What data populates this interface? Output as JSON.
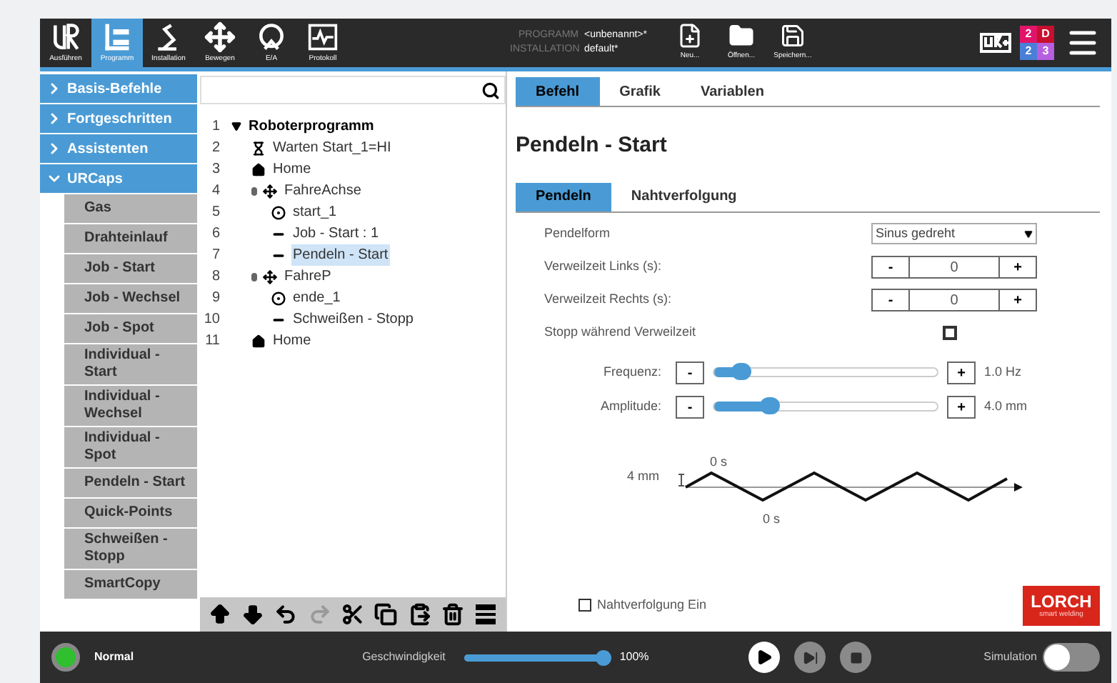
{
  "header": {
    "nav": [
      {
        "label": "Ausführen",
        "kind": "ur",
        "selected": false
      },
      {
        "label": "Programm",
        "kind": "program",
        "selected": true
      },
      {
        "label": "Installation",
        "kind": "robot",
        "selected": false
      },
      {
        "label": "Bewegen",
        "kind": "move",
        "selected": false
      },
      {
        "label": "E/A",
        "kind": "io",
        "selected": false
      },
      {
        "label": "Protokoll",
        "kind": "log",
        "selected": false
      }
    ],
    "program_label": "PROGRAMM",
    "program_value": "<unbenannt>*",
    "installation_label": "INSTALLATION",
    "installation_value": "default*",
    "file_buttons": [
      {
        "label": "Neu...",
        "kind": "new"
      },
      {
        "label": "Öffnen...",
        "kind": "open"
      },
      {
        "label": "Speichern...",
        "kind": "save"
      }
    ],
    "badge": [
      {
        "text": "2",
        "color": "#e0156a"
      },
      {
        "text": "D",
        "color": "#c8102e"
      },
      {
        "text": "2",
        "color": "#4a7fd8"
      },
      {
        "text": "3",
        "color": "#b65fe0"
      }
    ]
  },
  "sidebar": {
    "categories": [
      {
        "label": "Basis-Befehle",
        "expanded": false
      },
      {
        "label": "Fortgeschritten",
        "expanded": false
      },
      {
        "label": "Assistenten",
        "expanded": false
      },
      {
        "label": "URCaps",
        "expanded": true
      }
    ],
    "items": [
      "Gas",
      "Drahteinlauf",
      "Job - Start",
      "Job - Wechsel",
      "Job - Spot",
      "Individual - Start",
      "Individual - Wechsel",
      "Individual - Spot",
      "Pendeln - Start",
      "Quick-Points",
      "Schweißen - Stopp",
      "SmartCopy"
    ]
  },
  "tree": {
    "rows": [
      {
        "number": "1",
        "label": "Roboterprogramm",
        "kind": "root",
        "selected": false,
        "children": [
          {
            "number": "2",
            "label": "Warten Start_1=HI",
            "kind": "wait",
            "selected": false
          },
          {
            "number": "3",
            "label": "Home",
            "kind": "home",
            "selected": false
          },
          {
            "number": "4",
            "label": "FahreAchse",
            "kind": "move",
            "selected": false,
            "children": [
              {
                "number": "5",
                "label": "start_1",
                "kind": "waypoint",
                "selected": false
              },
              {
                "number": "6",
                "label": "Job - Start : 1",
                "kind": "command",
                "selected": false
              },
              {
                "number": "7",
                "label": "Pendeln - Start",
                "kind": "command",
                "selected": true
              }
            ]
          },
          {
            "number": "8",
            "label": "FahreP",
            "kind": "move",
            "selected": false,
            "children": [
              {
                "number": "9",
                "label": "ende_1",
                "kind": "waypoint",
                "selected": false
              },
              {
                "number": "10",
                "label": "Schweißen - Stopp",
                "kind": "command",
                "selected": false
              }
            ]
          },
          {
            "number": "11",
            "label": "Home",
            "kind": "home",
            "selected": false
          }
        ]
      }
    ],
    "toolbar": [
      {
        "kind": "up",
        "disabled": false
      },
      {
        "kind": "down",
        "disabled": false
      },
      {
        "kind": "undo",
        "disabled": false
      },
      {
        "kind": "redo",
        "disabled": true
      },
      {
        "kind": "cut",
        "disabled": false
      },
      {
        "kind": "copy",
        "disabled": false
      },
      {
        "kind": "paste",
        "disabled": false
      },
      {
        "kind": "delete",
        "disabled": false
      },
      {
        "kind": "suppress",
        "disabled": false
      }
    ]
  },
  "tabs": [
    {
      "label": "Befehl",
      "selected": true
    },
    {
      "label": "Grafik",
      "selected": false
    },
    {
      "label": "Variablen",
      "selected": false
    }
  ],
  "title": "Pendeln - Start",
  "subtabs": [
    {
      "label": "Pendeln",
      "selected": true
    },
    {
      "label": "Nahtverfolgung",
      "selected": false
    }
  ],
  "form": [
    {
      "kind": "dropdown",
      "label": "Pendelform",
      "value": "Sinus gedreht"
    },
    {
      "kind": "stepper",
      "label": "Verweilzeit Links (s):",
      "minus": "-",
      "value": "0",
      "plus": "+"
    },
    {
      "kind": "stepper",
      "label": "Verweilzeit Rechts (s):",
      "minus": "-",
      "value": "0",
      "plus": "+"
    },
    {
      "kind": "checkbox",
      "label": "Stopp während Verweilzeit",
      "checked": false
    }
  ],
  "sliders": [
    {
      "label": "Frequenz:",
      "minus": "-",
      "plus": "+",
      "level": 0.12,
      "reading": "1.0 Hz"
    },
    {
      "label": "Amplitude:",
      "minus": "-",
      "plus": "+",
      "level": 0.25,
      "reading": "4.0 mm"
    }
  ],
  "diagram": {
    "amplitude": "4 mm",
    "dwell_top": "0 s",
    "dwell_bottom": "0 s"
  },
  "seam_tracking": {
    "label": "Nahtverfolgung Ein",
    "checked": false
  },
  "logo": {
    "name": "LORCH",
    "tagline": "smart welding"
  },
  "footer": {
    "status": "Normal",
    "speed_label": "Geschwindigkeit",
    "speed": {
      "level": 1.0,
      "reading": "100%"
    },
    "simulation_label": "Simulation",
    "simulation_on": false
  }
}
